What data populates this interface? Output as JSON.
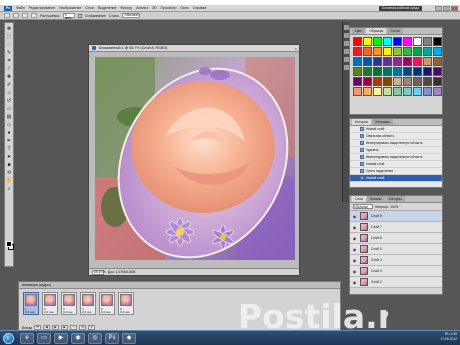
{
  "app": {
    "logo": "Ps",
    "menu": [
      "Файл",
      "Редактирование",
      "Изображение",
      "Слои",
      "Выделение",
      "Фильтр",
      "Анализ",
      "3D",
      "Просмотр",
      "Окно",
      "Справка"
    ],
    "workspace_button": "Основная рабочая среда"
  },
  "options": {
    "label_feather": "Растушевка:",
    "feather_value": "0 пикс",
    "label_smooth": "Сглаживание",
    "label_style": "Стиль:",
    "style_value": "Обычный"
  },
  "tools": [
    {
      "icon": "move-icon",
      "glyph": "✥"
    },
    {
      "icon": "marquee-icon",
      "glyph": "⬚"
    },
    {
      "icon": "lasso-icon",
      "glyph": "◌"
    },
    {
      "icon": "quick-select-icon",
      "glyph": "✎"
    },
    {
      "icon": "crop-icon",
      "glyph": "⌗"
    },
    {
      "icon": "eyedropper-icon",
      "glyph": "⁄"
    },
    {
      "icon": "healing-icon",
      "glyph": "✚"
    },
    {
      "icon": "brush-icon",
      "glyph": "✐"
    },
    {
      "icon": "stamp-icon",
      "glyph": "⊥"
    },
    {
      "icon": "history-brush-icon",
      "glyph": "↺"
    },
    {
      "icon": "eraser-icon",
      "glyph": "▱"
    },
    {
      "icon": "gradient-icon",
      "glyph": "▤"
    },
    {
      "icon": "blur-icon",
      "glyph": "◇"
    },
    {
      "icon": "dodge-icon",
      "glyph": "●"
    },
    {
      "icon": "pen-icon",
      "glyph": "✒"
    },
    {
      "icon": "type-icon",
      "glyph": "T"
    },
    {
      "icon": "path-select-icon",
      "glyph": "➤"
    },
    {
      "icon": "shape-icon",
      "glyph": "■"
    },
    {
      "icon": "3d-rotate-icon",
      "glyph": "⟲"
    },
    {
      "icon": "hand-icon",
      "glyph": "✋"
    },
    {
      "icon": "zoom-icon",
      "glyph": "⌕"
    }
  ],
  "document": {
    "title": "Безымянный-1 @ 66,7% (Слой 8, RGB/8)",
    "close": "×",
    "zoom": "66,67%",
    "doc_info": "Док: 1,07М/6,34М"
  },
  "panels": {
    "swatches_tabs": [
      "Цвет",
      "Образцы",
      "Стили"
    ],
    "swatch_colors": [
      "#ff0000",
      "#ffff00",
      "#00ff00",
      "#00ffff",
      "#0000ff",
      "#ff00ff",
      "#ffffff",
      "#808080",
      "#000000",
      "#ed1c24",
      "#f26522",
      "#f7941d",
      "#fff200",
      "#8dc63f",
      "#39b54a",
      "#00a651",
      "#00a99d",
      "#00aeef",
      "#0072bc",
      "#0054a6",
      "#2e3192",
      "#662d91",
      "#92278f",
      "#9e005d",
      "#ed145b",
      "#c69c6d",
      "#8c6239",
      "#598527",
      "#1a7b30",
      "#007236",
      "#00746b",
      "#0076a3",
      "#004a80",
      "#003471",
      "#1b1464",
      "#440e62",
      "#630460",
      "#9e0039",
      "#a0410d",
      "#7d4900",
      "#c7b299",
      "#998675",
      "#736357",
      "#534741",
      "#362f2d",
      "#f69679",
      "#fbaf5d",
      "#fff799",
      "#c4df9b",
      "#82ca9c",
      "#7accc8",
      "#6dcff6",
      "#8393ca",
      "#a187be"
    ],
    "history_tabs": [
      "История",
      "Операции"
    ],
    "history": [
      "Новый слой",
      "Овальная область",
      "Инвертировать выделенную область",
      "Удалить",
      "Инвертировать выделенную область",
      "Новый слой",
      "Снять выделение",
      "Новый слой"
    ],
    "layers_tabs": [
      "Слои",
      "Каналы",
      "Контуры"
    ],
    "layers_mode": "Обычные",
    "layers_opacity_label": "Непрозр.: 100%",
    "layers": [
      "Слой 8",
      "Слой 7",
      "Слой 6",
      "Слой 5",
      "Слой 4",
      "Слой 3",
      "Слой 2"
    ]
  },
  "animation": {
    "title": "Анимация (кадры)",
    "frames": [
      {
        "num": "1",
        "time": "0,2 сек."
      },
      {
        "num": "2",
        "time": "0,2 сек."
      },
      {
        "num": "3",
        "time": "0,2 сек."
      },
      {
        "num": "4",
        "time": "0,2 сек."
      },
      {
        "num": "5",
        "time": "0,2 сек."
      },
      {
        "num": "6",
        "time": "0,2 сек."
      }
    ],
    "loop": "Всегда"
  },
  "taskbar": {
    "apps": [
      {
        "icon": "ie-icon",
        "glyph": "e"
      },
      {
        "icon": "explorer-icon",
        "glyph": "▭"
      },
      {
        "icon": "media-player-icon",
        "glyph": "▶"
      },
      {
        "icon": "browser-icon",
        "glyph": "◉"
      },
      {
        "icon": "chrome-icon",
        "glyph": "◎"
      },
      {
        "icon": "photoshop-icon",
        "glyph": "Ps"
      },
      {
        "icon": "vk-icon",
        "glyph": "◆"
      }
    ],
    "lang": "RU",
    "time": "1:49",
    "date": "17.05.2012"
  },
  "watermark": "Postila.ru",
  "colors": {
    "app_bg": "#565656",
    "accent": "#2f5fb4",
    "watermark": "#f2f2f2"
  }
}
